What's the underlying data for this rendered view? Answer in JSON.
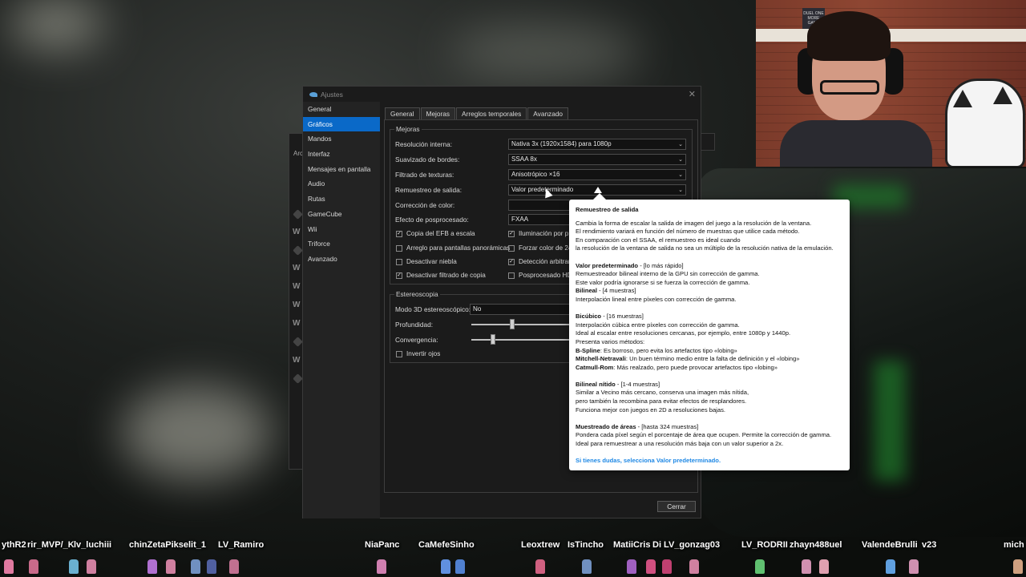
{
  "settings_window": {
    "title": "Ajustes",
    "sidebar": [
      "General",
      "Gráficos",
      "Mandos",
      "Interfaz",
      "Mensajes en pantalla",
      "Audio",
      "Rutas",
      "GameCube",
      "Wii",
      "Triforce",
      "Avanzado"
    ],
    "sidebar_active": "Gráficos",
    "tabs": [
      "General",
      "Mejoras",
      "Arreglos temporales",
      "Avanzado"
    ],
    "tab_active": "Mejoras",
    "mejoras": {
      "label": "Mejoras",
      "resolucion_label": "Resolución interna:",
      "resolucion_value": "Nativa 3x (1920x1584) para 1080p",
      "suavizado_label": "Suavizado de bordes:",
      "suavizado_value": "SSAA 8x",
      "filtrado_label": "Filtrado de texturas:",
      "filtrado_value": "Anisotrópico ×16",
      "remuestreo_label": "Remuestreo de salida:",
      "remuestreo_value": "Valor predeterminado",
      "correccion_label": "Corrección de color:",
      "correccion_value": "",
      "efecto_label": "Efecto de posprocesado:",
      "efecto_value": "FXAA",
      "checks_left": [
        {
          "label": "Copia del EFB a escala",
          "checked": true
        },
        {
          "label": "Arreglo para pantallas panorámicas",
          "checked": false
        },
        {
          "label": "Desactivar niebla",
          "checked": false
        },
        {
          "label": "Desactivar filtrado de copia",
          "checked": true
        }
      ],
      "checks_right": [
        {
          "label": "Iluminación por p",
          "checked": true
        },
        {
          "label": "Forzar color de 24",
          "checked": false
        },
        {
          "label": "Detección arbitrar",
          "checked": true
        },
        {
          "label": "Posprocesado HD",
          "checked": false
        }
      ]
    },
    "estereoscopia": {
      "label": "Estereoscopia",
      "modo_label": "Modo 3D estereoscópico:",
      "modo_value": "No",
      "profundidad_label": "Profundidad:",
      "profundidad_level": 0.42,
      "convergencia_label": "Convergencia:",
      "convergencia_level": 0.22,
      "invertir_label": "Invertir ojos",
      "invertir_checked": false
    },
    "close_button": "Cerrar"
  },
  "background_window": {
    "title_fragment": "Arc",
    "w_letters": [
      "W",
      "W",
      "W",
      "W",
      "W",
      "W"
    ]
  },
  "tooltip": {
    "title": "Remuestreo de salida",
    "intro": [
      "Cambia la forma de escalar la salida de imagen del juego a la resolución de la ventana.",
      "El rendimiento variará en función del número de muestras que utilice cada método.",
      "En comparación con el SSAA, el remuestreo es ideal cuando",
      "la resolución de la ventana de salida no sea un múltiplo de la resolución nativa de la emulación."
    ],
    "default_name": "Valor predeterminado",
    "default_tag": " - [lo más rápido]",
    "default_lines": [
      "Remuestreador bilineal interno de la GPU sin corrección de gamma.",
      "Este valor podría ignorarse si se fuerza la corrección de gamma."
    ],
    "bilineal_name": "Bilineal",
    "bilineal_tag": " - [4 muestras]",
    "bilineal_line": "Interpolación lineal entre píxeles con corrección de gamma.",
    "bicubico_name": "Bicúbico",
    "bicubico_tag": " - [16 muestras]",
    "bicubico_lines": [
      "Interpolación cúbica entre píxeles con corrección de gamma.",
      "Ideal al escalar entre resoluciones cercanas, por ejemplo, entre 1080p y 1440p.",
      "Presenta varios métodos:"
    ],
    "bspline_name": "B-Spline",
    "bspline_text": ": Es borroso, pero evita los artefactos tipo «lobing»",
    "mitchell_name": "Mitchell-Netravali",
    "mitchell_text": ": Un buen término medio entre la falta de definición y el «lobing»",
    "catmull_name": "Catmull-Rom",
    "catmull_text": ": Más realzado, pero puede provocar artefactos tipo «lobing»",
    "nitido_name": "Bilineal nítido",
    "nitido_tag": " - [1-4 muestras]",
    "nitido_lines": [
      "Similar a Vecino más cercano, conserva una imagen más nítida,",
      "pero también la recombina para evitar efectos de resplandores.",
      "Funciona mejor con juegos en 2D a resoluciones bajas."
    ],
    "areas_name": "Muestreado de áreas",
    "areas_tag": " - [hasta 324 muestras]",
    "areas_lines": [
      "Pondera cada píxel según el porcentaje de área que ocupen. Permite la corrección de gamma.",
      "Ideal para remuestrear a una resolución más baja con un valor superior a 2x."
    ],
    "footer": "Si tienes dudas, selecciona Valor predeterminado."
  },
  "webcam": {
    "poster_text": "DUEL ONE MORE GAME"
  },
  "chat_names": [
    "ythR2",
    "rir_MVP/_K",
    "lv_luchiii",
    "chinZetaPikselit_1",
    "LV_Ramiro",
    "NiaPanc",
    "CaMefeSinho",
    "Leoxtrew",
    "IsTincho",
    "MatiiCris",
    "Di LV_gonzag03",
    "LV_RODRII",
    "zhayn488uel",
    "ValendeBrulli",
    "v23",
    "mich"
  ],
  "colors": {
    "accent": "#0a69c8",
    "link": "#1e88e5",
    "window_bg": "#1b1b1b"
  }
}
